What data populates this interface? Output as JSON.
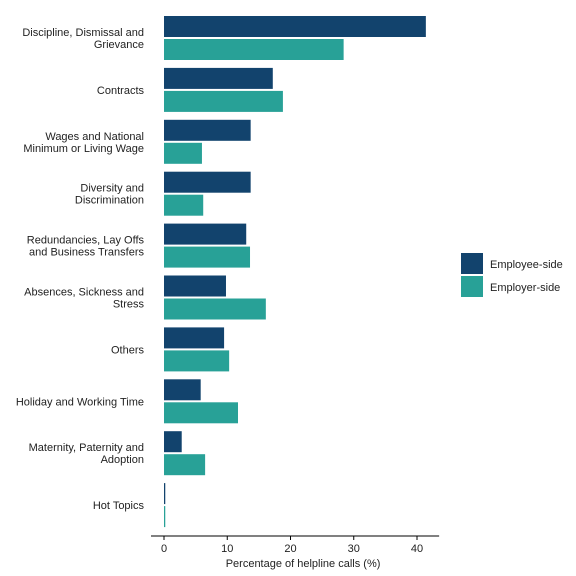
{
  "chart_data": {
    "type": "bar",
    "orientation": "horizontal",
    "title": "",
    "xlabel": "Percentage of helpline calls (%)",
    "ylabel": "",
    "xlim": [
      0,
      43.5
    ],
    "xticks": [
      0,
      10,
      20,
      30,
      40
    ],
    "grid": false,
    "legend_position": "right",
    "categories": [
      [
        "Discipline, Dismissal and",
        "Grievance"
      ],
      [
        "Contracts"
      ],
      [
        "Wages and National",
        "Minimum or Living Wage"
      ],
      [
        "Diversity and",
        "Discrimination"
      ],
      [
        "Redundancies, Lay Offs",
        "and Business Transfers"
      ],
      [
        "Absences, Sickness and",
        "Stress"
      ],
      [
        "Others"
      ],
      [
        "Holiday and Working Time"
      ],
      [
        "Maternity, Paternity and",
        "Adoption"
      ],
      [
        "Hot Topics"
      ]
    ],
    "series": [
      {
        "name": "Employee-side",
        "color": "#12436d",
        "values": [
          41.4,
          17.2,
          13.7,
          13.7,
          13.0,
          9.8,
          9.5,
          5.8,
          2.8,
          0.2
        ]
      },
      {
        "name": "Employer-side",
        "color": "#28a197",
        "values": [
          28.4,
          18.8,
          6.0,
          6.2,
          13.6,
          16.1,
          10.3,
          11.7,
          6.5,
          0.2
        ]
      }
    ]
  }
}
